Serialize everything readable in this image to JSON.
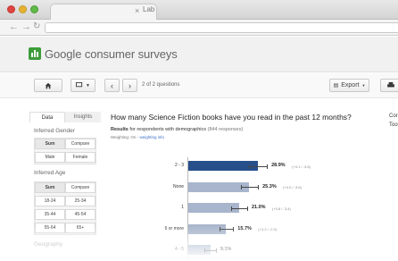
{
  "browser": {
    "tab_title": "Lab",
    "tab_close": "×"
  },
  "app": {
    "brand": "Google consumer surveys"
  },
  "toolbar": {
    "pager": "2 of 2 questions",
    "export_label": "Export"
  },
  "sidebar": {
    "tabs": [
      "Data",
      "Insights"
    ],
    "gender_label": "Inferred Gender",
    "gender_options": [
      "Sum",
      "Compare",
      "Male",
      "Female"
    ],
    "age_label": "Inferred Age",
    "age_options": [
      "Sum",
      "Compare",
      "18-24",
      "25-34",
      "35-44",
      "45-54",
      "55-64",
      "65+"
    ],
    "geo_label": "Geography"
  },
  "main": {
    "question": "How many Science Fiction books have you read in the past 12 months?",
    "results_prefix": "Results",
    "results_middle": "for respondents with demographics",
    "responses": "(844 responses)",
    "weighting_prefix": "Weighting: On -",
    "weighting_link": "weighting info",
    "side_top": "Cor",
    "side_bottom": "Too"
  },
  "chart_data": {
    "type": "bar",
    "orientation": "horizontal",
    "categories": [
      "2 - 3",
      "None",
      "1",
      "6 or more",
      "4 - 5"
    ],
    "values": [
      28.9,
      25.3,
      21.0,
      15.7,
      9.1
    ],
    "value_labels": [
      "28.9%",
      "25.3%",
      "21.0%",
      "15.7%",
      "9.1%"
    ],
    "ci_labels": [
      "(+4.1 / -3.8)",
      "(+4.0 / -3.6)",
      "(+3.8 / -3.4)",
      "(+3.3 / -2.9)",
      ""
    ],
    "ci_plus": [
      4.1,
      4.0,
      3.8,
      3.3,
      2.7
    ],
    "ci_minus": [
      3.8,
      3.6,
      3.4,
      2.9,
      2.3
    ],
    "highlight_color": "#27508b",
    "bar_color": "#a8b5cc"
  }
}
